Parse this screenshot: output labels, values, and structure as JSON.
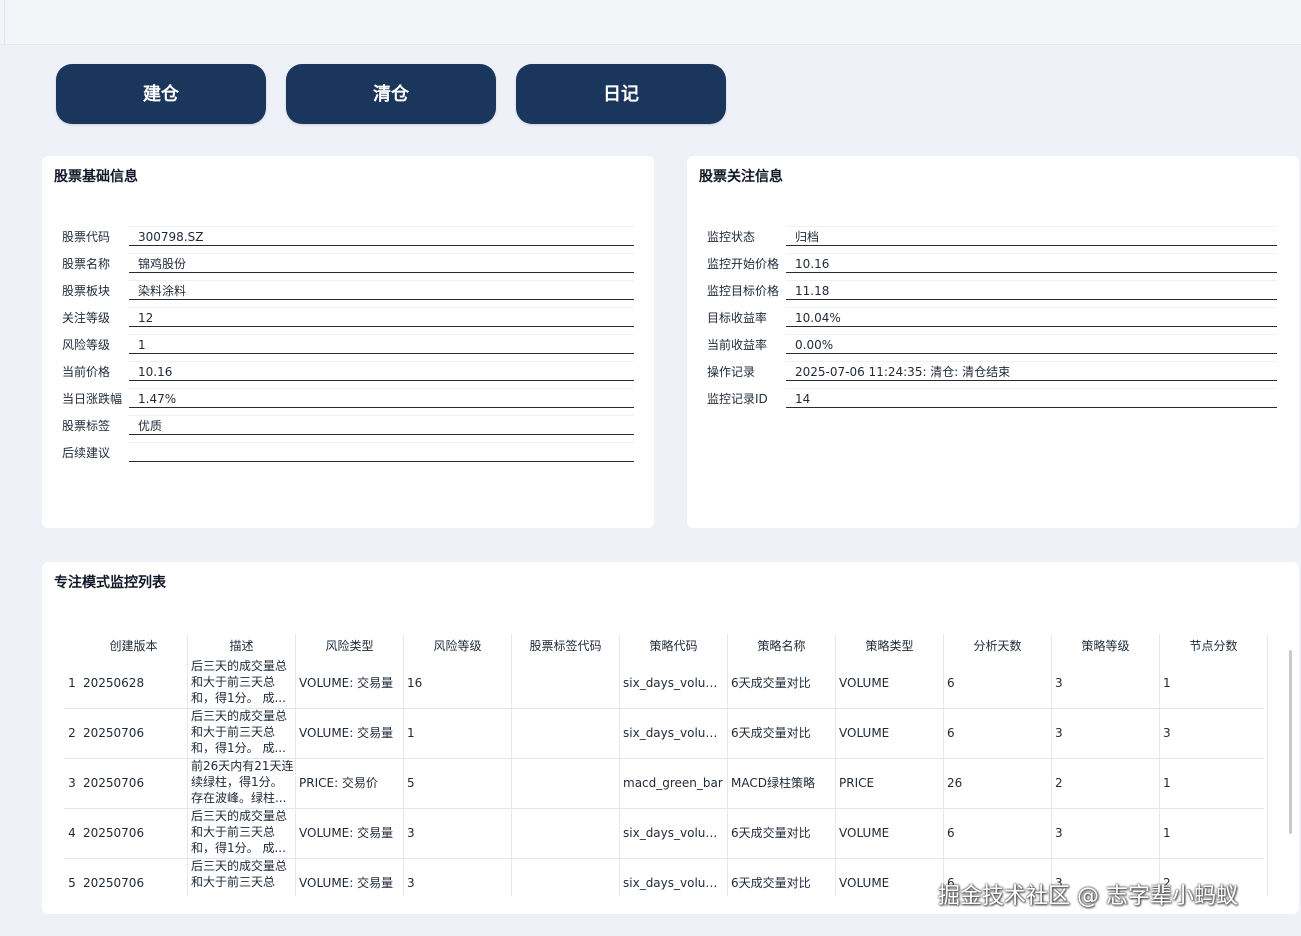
{
  "buttons": {
    "build": "建仓",
    "clear": "清仓",
    "diary": "日记"
  },
  "basic_info": {
    "title": "股票基础信息",
    "fields": [
      {
        "label": "股票代码",
        "value": "300798.SZ"
      },
      {
        "label": "股票名称",
        "value": "锦鸡股份"
      },
      {
        "label": "股票板块",
        "value": "染料涂料"
      },
      {
        "label": "关注等级",
        "value": "12"
      },
      {
        "label": "风险等级",
        "value": "1"
      },
      {
        "label": "当前价格",
        "value": "10.16"
      },
      {
        "label": "当日涨跌幅",
        "value": "1.47%"
      },
      {
        "label": "股票标签",
        "value": "优质"
      },
      {
        "label": "后续建议",
        "value": ""
      }
    ]
  },
  "watch_info": {
    "title": "股票关注信息",
    "fields": [
      {
        "label": "监控状态",
        "value": "归档"
      },
      {
        "label": "监控开始价格",
        "value": "10.16"
      },
      {
        "label": "监控目标价格",
        "value": "11.18"
      },
      {
        "label": "目标收益率",
        "value": "10.04%"
      },
      {
        "label": "当前收益率",
        "value": "0.00%"
      },
      {
        "label": "操作记录",
        "value": "2025-07-06 11:24:35: 清仓: 清仓结束"
      },
      {
        "label": "监控记录ID",
        "value": "14"
      }
    ]
  },
  "focus_list": {
    "title": "专注模式监控列表",
    "columns": [
      "创建版本",
      "描述",
      "风险类型",
      "风险等级",
      "股票标签代码",
      "策略代码",
      "策略名称",
      "策略类型",
      "分析天数",
      "策略等级",
      "节点分数"
    ],
    "rows": [
      {
        "num": "1",
        "cells": [
          "20250628",
          "后三天的成交量总和大于前三天总和，得1分。 成...",
          "VOLUME: 交易量",
          "16",
          "",
          "six_days_volum...",
          "6天成交量对比",
          "VOLUME",
          "6",
          "3",
          "1"
        ]
      },
      {
        "num": "2",
        "cells": [
          "20250706",
          "后三天的成交量总和大于前三天总和，得1分。 成...",
          "VOLUME: 交易量",
          "1",
          "",
          "six_days_volum...",
          "6天成交量对比",
          "VOLUME",
          "6",
          "3",
          "3"
        ]
      },
      {
        "num": "3",
        "cells": [
          "20250706",
          "前26天内有21天连续绿柱，得1分。 存在波峰。绿柱...",
          "PRICE: 交易价",
          "5",
          "",
          "macd_green_bar",
          "MACD绿柱策略",
          "PRICE",
          "26",
          "2",
          "1"
        ]
      },
      {
        "num": "4",
        "cells": [
          "20250706",
          "后三天的成交量总和大于前三天总和，得1分。 成...",
          "VOLUME: 交易量",
          "3",
          "",
          "six_days_volum...",
          "6天成交量对比",
          "VOLUME",
          "6",
          "3",
          "1"
        ]
      },
      {
        "num": "5",
        "cells": [
          "20250706",
          "后三天的成交量总和大于前三天总",
          "VOLUME: 交易量",
          "3",
          "",
          "six_days_volum...",
          "6天成交量对比",
          "VOLUME",
          "6",
          "3",
          "2"
        ]
      }
    ]
  },
  "watermark": "掘金技术社区 @ 志字辈小蚂蚁"
}
